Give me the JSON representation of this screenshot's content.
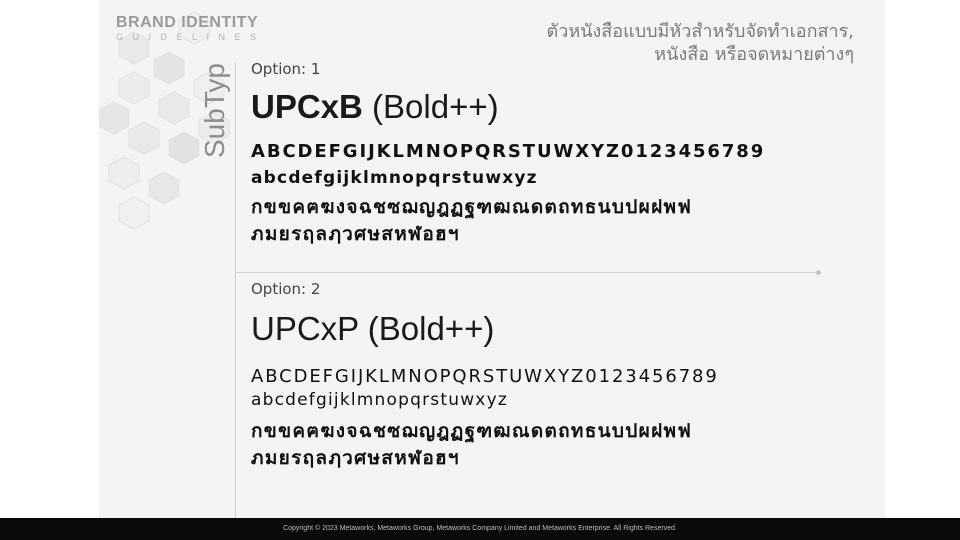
{
  "brand": {
    "title": "BRAND IDENTITY",
    "subtitle": "GUIDELINES"
  },
  "header": {
    "thai_line1": "ตัวหนังสือแบบมีหัวสำหรับจัดทำเอกสาร,",
    "thai_line2": "หนังสือ หรือจดหมายต่างๆ"
  },
  "section_label": "SubTyp",
  "option1": {
    "label": "Option: 1",
    "font_name": "UPCxB",
    "weight_note": "(Bold++)",
    "uppercase": "ABCDEFGIJKLMNOPQRSTUWXYZ0123456789",
    "lowercase": "abcdefgijklmnopqrstuwxyz",
    "thai_line1": "กขขคฅฆงจฉชซฌญฎฏฐฑฒณดตถทธนบปผฝพฟ",
    "thai_line2": "ภมยรฤลฦวศษสหฬอฮฯ"
  },
  "option2": {
    "label": "Option: 2",
    "font_name": "UPCxP",
    "weight_note": "(Bold++)",
    "uppercase": "ABCDEFGIJKLMNOPQRSTUWXYZ0123456789",
    "lowercase": "abcdefgijklmnopqrstuwxyz",
    "thai_line1": "กขขคฅฆงจฉชซฌญฎฏฐฑฒณดตถทธนบปผฝพฟ",
    "thai_line2": "ภมยรฤลฦวศษสหฬอฮฯ"
  },
  "footer": {
    "copyright": "Copyright © 2023 Metaworks, Metaworks Group, Metaworks Company Limited and Metaworks Enterprise. All Rights Reserved."
  },
  "colors": {
    "page_bg": "#f4f4f4",
    "footer_bg": "#0a0a0a",
    "accent_gray": "#9a9a9a"
  }
}
